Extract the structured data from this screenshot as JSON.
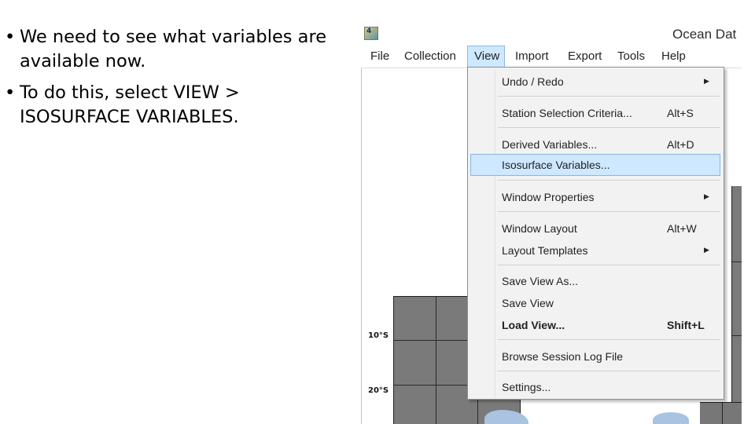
{
  "slide": {
    "bullets": [
      "We need to see what variables are available now.",
      "To do this, select VIEW > ISOSURFACE VARIABLES."
    ]
  },
  "window": {
    "title": "Ocean Dat",
    "icon_text": "4"
  },
  "menubar": {
    "items": [
      "File",
      "Collection",
      "View",
      "Import",
      "Export",
      "Tools",
      "Help"
    ],
    "active": "View"
  },
  "view_menu": {
    "items": [
      {
        "label": "Undo / Redo",
        "shortcut": "",
        "submenu": true
      },
      {
        "label": "Station Selection Criteria...",
        "shortcut": "Alt+S",
        "submenu": false
      },
      {
        "label": "Derived Variables...",
        "shortcut": "Alt+D",
        "submenu": false
      },
      {
        "label": "Isosurface Variables...",
        "shortcut": "",
        "submenu": false,
        "highlighted": true
      },
      {
        "label": "Window Properties",
        "shortcut": "",
        "submenu": true
      },
      {
        "label": "Window Layout",
        "shortcut": "Alt+W",
        "submenu": false
      },
      {
        "label": "Layout Templates",
        "shortcut": "",
        "submenu": true
      },
      {
        "label": "Save View As...",
        "shortcut": "",
        "submenu": false
      },
      {
        "label": "Save View",
        "shortcut": "",
        "submenu": false
      },
      {
        "label": "Load View...",
        "shortcut": "Shift+L",
        "submenu": false,
        "bold": true
      },
      {
        "label": "Browse Session Log File",
        "shortcut": "",
        "submenu": false
      },
      {
        "label": "Settings...",
        "shortcut": "",
        "submenu": false
      }
    ],
    "submenu_glyph": "▶"
  },
  "map": {
    "lat_labels": [
      "10°S",
      "20°S"
    ]
  }
}
